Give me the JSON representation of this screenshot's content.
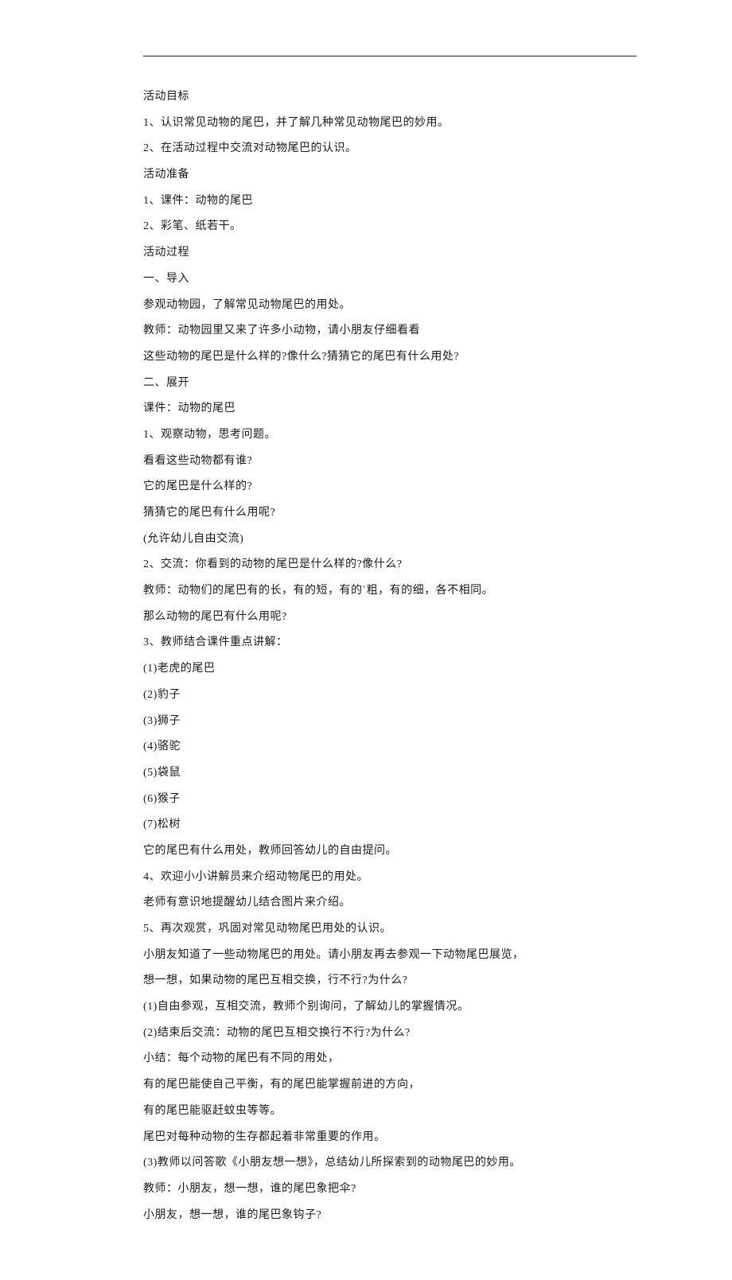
{
  "lines": [
    "活动目标",
    "1、认识常见动物的尾巴，并了解几种常见动物尾巴的妙用。",
    "2、在活动过程中交流对动物尾巴的认识。",
    "活动准备",
    "1、课件：动物的尾巴",
    "2、彩笔、纸若干。",
    "活动过程",
    "一、导入",
    "参观动物园，了解常见动物尾巴的用处。",
    "教师：动物园里又来了许多小动物，请小朋友仔细看看",
    "这些动物的尾巴是什么样的?像什么?猜猜它的尾巴有什么用处?",
    "二、展开",
    "课件：动物的尾巴",
    "1、观察动物，思考问题。",
    "看看这些动物都有谁?",
    "它的尾巴是什么样的?",
    "猜猜它的尾巴有什么用呢?",
    "(允许幼儿自由交流)",
    "2、交流：你看到的动物的尾巴是什么样的?像什么?",
    "教师：动物们的尾巴有的长，有的短，有的`粗，有的细，各不相同。",
    "那么动物的尾巴有什么用呢?",
    "3、教师结合课件重点讲解：",
    "(1)老虎的尾巴",
    "(2)豹子",
    "(3)狮子",
    "(4)骆驼",
    "(5)袋鼠",
    "(6)猴子",
    "(7)松树",
    "它的尾巴有什么用处，教师回答幼儿的自由提问。",
    "4、欢迎小小讲解员来介绍动物尾巴的用处。",
    "老师有意识地提醒幼儿结合图片来介绍。",
    "5、再次观赏，巩固对常见动物尾巴用处的认识。",
    "小朋友知道了一些动物尾巴的用处。请小朋友再去参观一下动物尾巴展览，",
    "想一想，如果动物的尾巴互相交换，行不行?为什么?",
    "(1)自由参观，互相交流，教师个别询问，了解幼儿的掌握情况。",
    "(2)结束后交流：动物的尾巴互相交换行不行?为什么?",
    "小结：每个动物的尾巴有不同的用处，",
    "有的尾巴能使自己平衡，有的尾巴能掌握前进的方向，",
    "有的尾巴能驱赶蚊虫等等。",
    "尾巴对每种动物的生存都起着非常重要的作用。",
    "(3)教师以问答歌《小朋友想一想》，总结幼儿所探索到的动物尾巴的妙用。",
    "教师：小朋友，想一想，谁的尾巴象把伞?",
    "小朋友，想一想，谁的尾巴象钩子?"
  ]
}
